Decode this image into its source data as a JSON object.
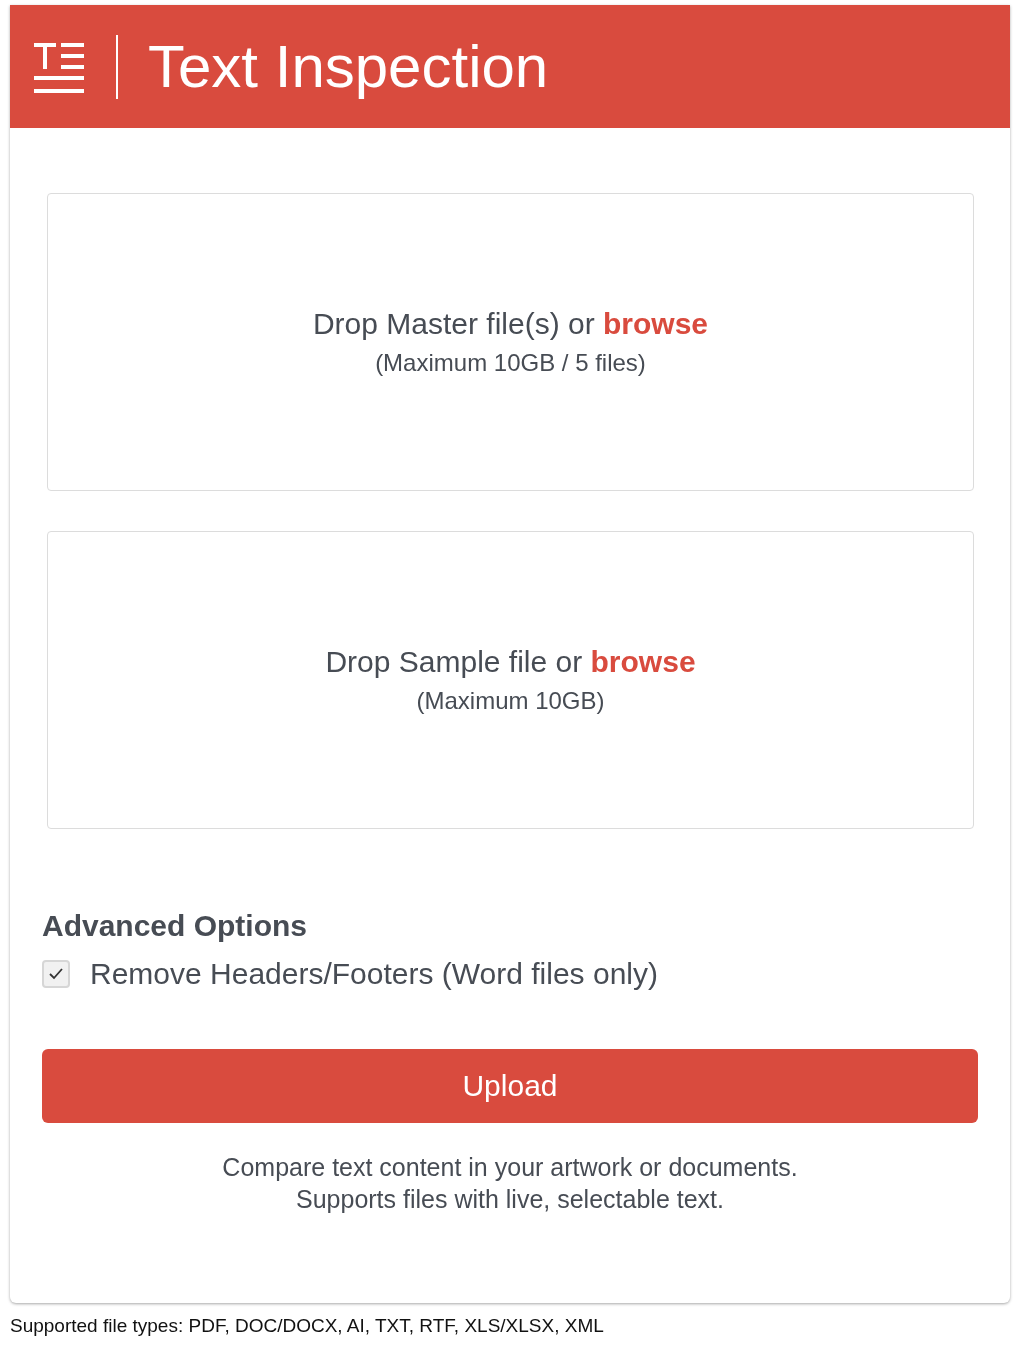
{
  "header": {
    "title": "Text Inspection"
  },
  "drop_zones": [
    {
      "prefix": "Drop Master file(s) or ",
      "link": "browse",
      "limit": "(Maximum 10GB / 5 files)"
    },
    {
      "prefix": "Drop Sample file or ",
      "link": "browse",
      "limit": "(Maximum 10GB)"
    }
  ],
  "advanced_options": {
    "title": "Advanced Options",
    "options": [
      {
        "label": "Remove Headers/Footers (Word files only)",
        "checked": true
      }
    ]
  },
  "upload_button": "Upload",
  "description": [
    "Compare text content in your artwork or documents.",
    "Supports files with live, selectable text."
  ],
  "footer": "Supported file types: PDF, DOC/DOCX, AI, TXT, RTF, XLS/XLSX, XML"
}
